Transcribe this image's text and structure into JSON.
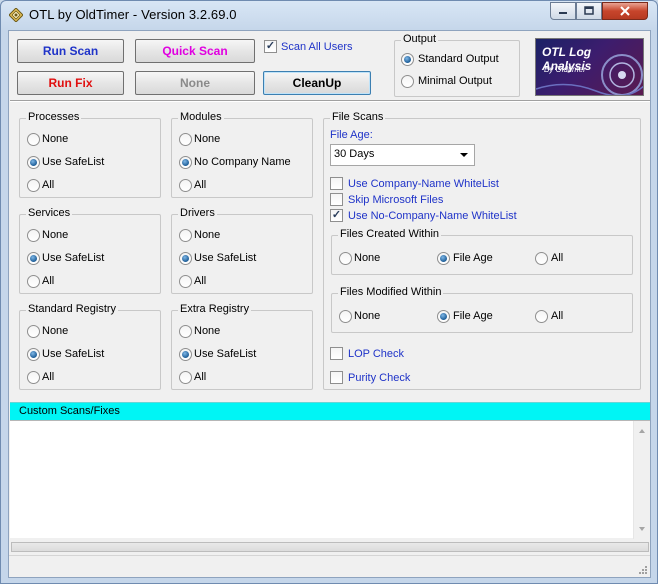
{
  "window": {
    "title": "OTL by OldTimer - Version 3.2.69.0",
    "title_color": "#000000",
    "frame_color": "#c9d9ea"
  },
  "toolbar": {
    "run_scan": "Run Scan",
    "run_scan_color": "#1f33c8",
    "quick_scan": "Quick Scan",
    "quick_scan_color": "#e000e0",
    "run_fix": "Run Fix",
    "run_fix_color": "#e01010",
    "none": "None",
    "none_color": "#8a8a8a",
    "cleanup": "CleanUp",
    "scan_all_users": "Scan All Users",
    "scan_all_users_checked": true
  },
  "output": {
    "title": "Output",
    "standard": "Standard Output",
    "minimal": "Minimal Output",
    "selected": "standard"
  },
  "logo": {
    "title": "OTL Log Analysis",
    "subtitle": "By Oldtimer"
  },
  "groups": {
    "processes": {
      "title": "Processes",
      "options": [
        "None",
        "Use SafeList",
        "All"
      ],
      "selected": 1
    },
    "modules": {
      "title": "Modules",
      "options": [
        "None",
        "No Company Name",
        "All"
      ],
      "selected": 1
    },
    "services": {
      "title": "Services",
      "options": [
        "None",
        "Use SafeList",
        "All"
      ],
      "selected": 1
    },
    "drivers": {
      "title": "Drivers",
      "options": [
        "None",
        "Use SafeList",
        "All"
      ],
      "selected": 1
    },
    "std_registry": {
      "title": "Standard Registry",
      "options": [
        "None",
        "Use SafeList",
        "All"
      ],
      "selected": 1
    },
    "extra_registry": {
      "title": "Extra Registry",
      "options": [
        "None",
        "Use SafeList",
        "All"
      ],
      "selected": 1
    }
  },
  "file_scans": {
    "title": "File Scans",
    "file_age_label": "File Age:",
    "file_age_value": "30 Days",
    "checks": [
      {
        "label": "Use Company-Name WhiteList",
        "checked": false
      },
      {
        "label": "Skip Microsoft Files",
        "checked": false
      },
      {
        "label": "Use No-Company-Name WhiteList",
        "checked": true
      }
    ],
    "created": {
      "title": "Files Created Within",
      "options": [
        "None",
        "File Age",
        "All"
      ],
      "selected": 1
    },
    "modified": {
      "title": "Files Modified Within",
      "options": [
        "None",
        "File Age",
        "All"
      ],
      "selected": 1
    },
    "lop_check": "LOP Check",
    "purity_check": "Purity Check"
  },
  "custom": {
    "label": "Custom Scans/Fixes",
    "bar_color": "#00f5f5",
    "text": ""
  }
}
